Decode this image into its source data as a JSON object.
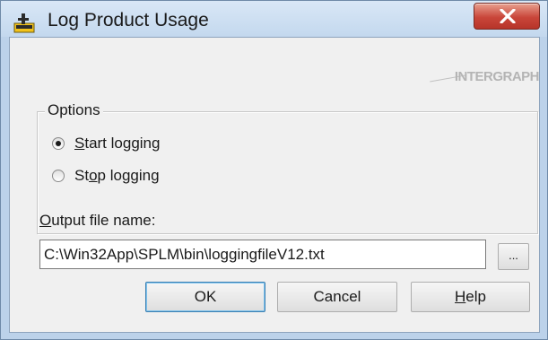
{
  "window": {
    "title": "Log Product Usage",
    "close_label": "X"
  },
  "logo": {
    "text": "INTERGRAPH"
  },
  "options": {
    "group_label": "Options",
    "radios": [
      {
        "prefix": "",
        "mnemonic": "S",
        "rest": "tart logging",
        "selected": true
      },
      {
        "prefix": "St",
        "mnemonic": "o",
        "rest": "p logging",
        "selected": false
      }
    ]
  },
  "output": {
    "label_mnemonic": "O",
    "label_rest": "utput file name:",
    "value": "C:\\Win32App\\SPLM\\bin\\loggingfileV12.txt",
    "browse_label": "..."
  },
  "buttons": {
    "ok": "OK",
    "cancel": "Cancel",
    "help_mnemonic": "H",
    "help_rest": "elp"
  },
  "icons": {
    "app": "app-icon",
    "close": "close-icon",
    "radio": "radio-icon"
  },
  "colors": {
    "titlebar": "#c8dbef",
    "close": "#c9463a",
    "dialog_bg": "#f0f0f0",
    "default_button_border": "#3c7fb1"
  }
}
